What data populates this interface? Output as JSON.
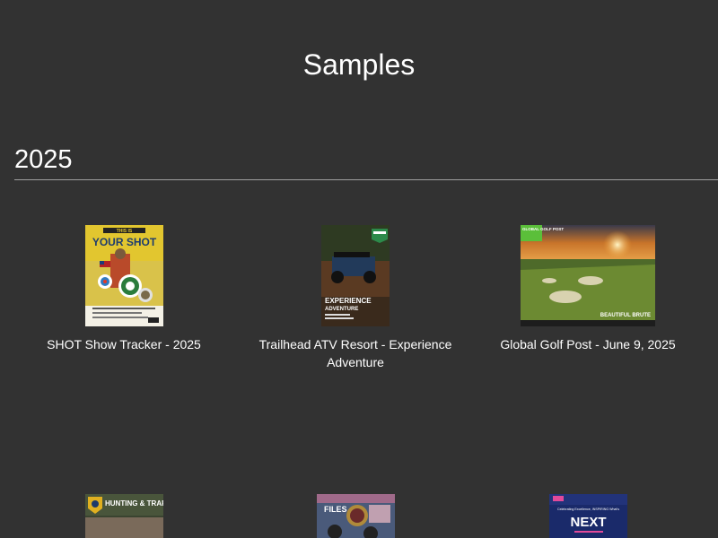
{
  "header": {
    "title": "Samples"
  },
  "section": {
    "year": "2025"
  },
  "samples": [
    {
      "caption": "SHOT Show Tracker - 2025",
      "cover_text_top": "THIS IS",
      "cover_text_main": "YOUR SHOT"
    },
    {
      "caption": "Trailhead ATV Resort - Experience Adventure",
      "cover_text_main": "EXPERIENCE",
      "cover_text_sub": "ADVENTURE",
      "cover_text_small": "Not Your Visitors Corporate Retreat"
    },
    {
      "caption": "Global Golf Post - June 9, 2025",
      "cover_text_logo": "GLOBAL GOLF POST",
      "cover_text_main": "BEAUTIFUL BRUTE"
    },
    {
      "cover_text_main": "HUNTING & TRAPPING"
    },
    {
      "cover_text_main": "FILES"
    },
    {
      "cover_text_top": "Celebrating Excellence, INSPIRING What's",
      "cover_text_main": "NEXT"
    }
  ]
}
